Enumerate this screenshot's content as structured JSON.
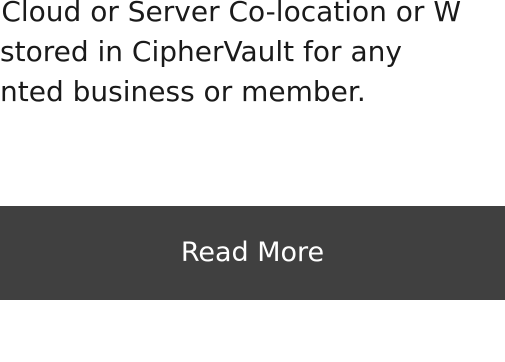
{
  "description": {
    "lines": [
      "/ Cloud or Server Co-location or W",
      "stored in CipherVault for any",
      "nted business or member."
    ]
  },
  "cta": {
    "label": "Read More",
    "background_color": "#404040",
    "text_color": "#ffffff"
  }
}
